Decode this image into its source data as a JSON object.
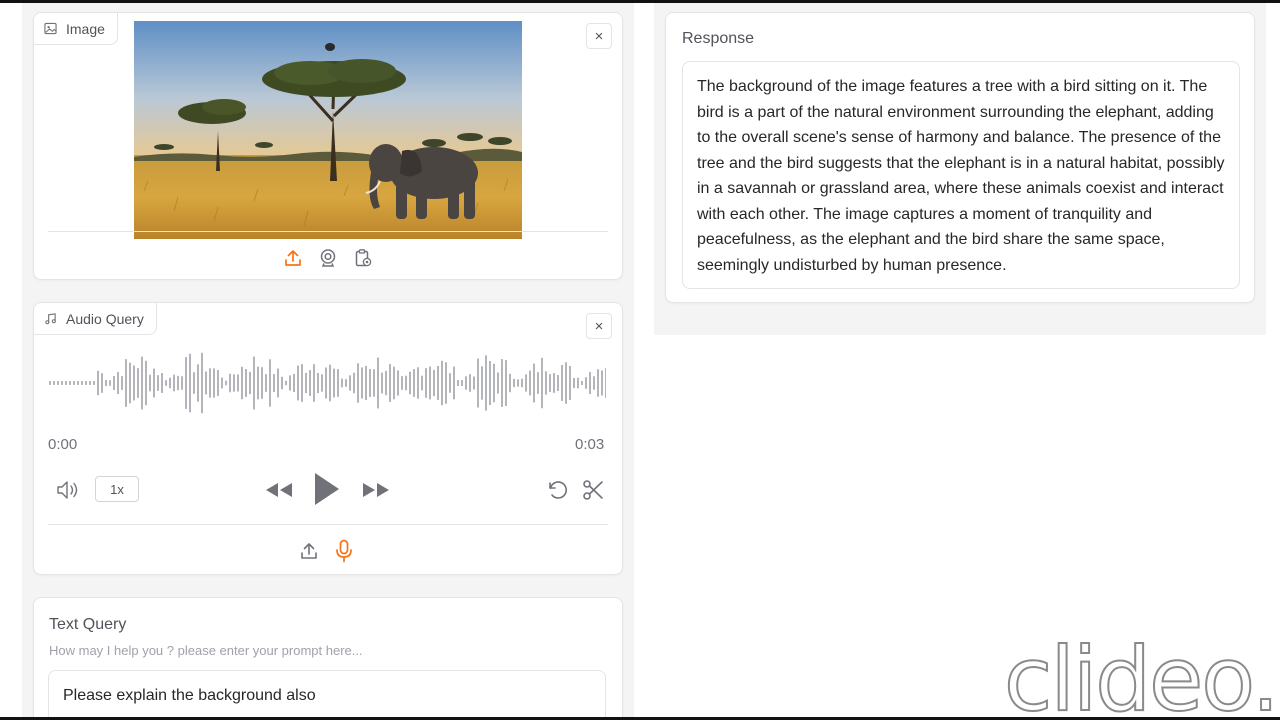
{
  "image_panel": {
    "label": "Image",
    "close_icon": "×",
    "toolbar": [
      "upload-icon",
      "webcam-icon",
      "clipboard-icon"
    ],
    "accent": "#f97316"
  },
  "audio_panel": {
    "label": "Audio Query",
    "close_icon": "×",
    "time_start": "0:00",
    "time_end": "0:03",
    "playback_rate": "1x",
    "controls": [
      "volume-icon",
      "rewind-icon",
      "play-icon",
      "fast-forward-icon",
      "undo-icon",
      "scissors-icon"
    ],
    "source_icons": [
      "upload-icon",
      "microphone-icon"
    ]
  },
  "text_panel": {
    "label": "Text Query",
    "info": "How may I help you ? please enter your prompt here...",
    "value": "Please explain the background also"
  },
  "response_panel": {
    "label": "Response",
    "text": "The background of the image features a tree with a bird sitting on it. The bird is a part of the natural environment surrounding the elephant, adding to the overall scene's sense of harmony and balance. The presence of the tree and the bird suggests that the elephant is in a natural habitat, possibly in a savannah or grassland area, where these animals coexist and interact with each other. The image captures a moment of tranquility and peacefulness, as the elephant and the bird share the same space, seemingly undisturbed by human presence."
  },
  "watermark": "clideo.c",
  "colors": {
    "accent": "#f97316",
    "panel_bg": "#f4f4f5",
    "border": "#e4e4e7",
    "waveform": "#a1a1aa"
  }
}
